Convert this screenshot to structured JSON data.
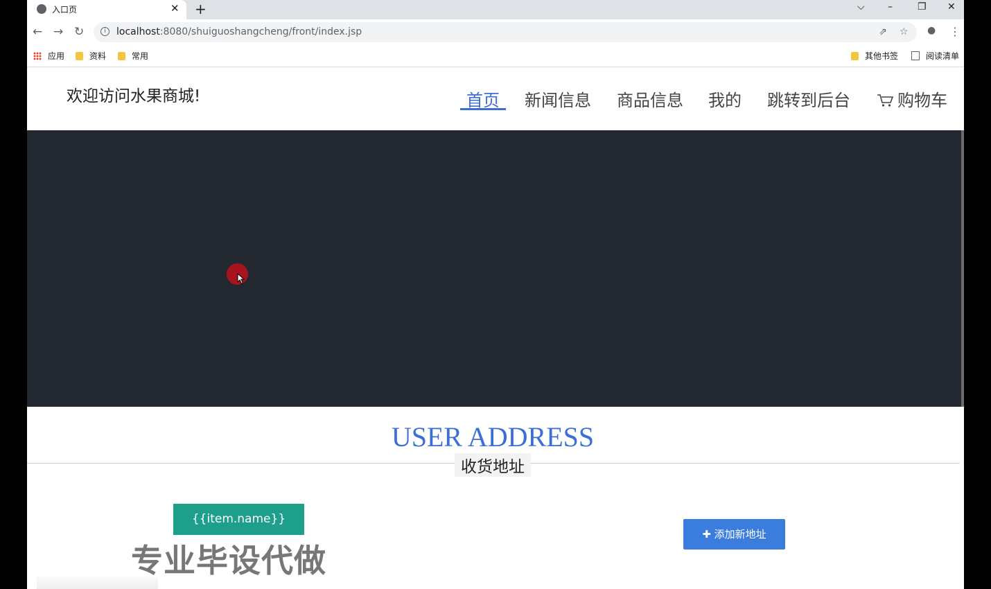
{
  "browser": {
    "tab_title": "入口页",
    "tab_close": "✕",
    "new_tab": "+",
    "window_controls": {
      "tab_search": "⌵",
      "minimize": "–",
      "restore": "❐",
      "close": "✕"
    },
    "nav": {
      "back": "←",
      "forward": "→",
      "reload": "↻"
    },
    "url_host": "localhost",
    "url_path": ":8080/shuiguoshangcheng/front/index.jsp",
    "info_icon": "i",
    "share_icon": "⇗",
    "star_icon": "☆",
    "profile_icon": "●",
    "menu_icon": "⋮",
    "bookmarks": [
      "应用",
      "资料",
      "常用"
    ],
    "other_bookmarks": "其他书签",
    "reading_list": "阅读清单"
  },
  "header": {
    "site_title": "欢迎访问水果商城!",
    "nav": [
      "首页",
      "新闻信息",
      "商品信息",
      "我的",
      "跳转到后台"
    ],
    "cart_label": "购物车",
    "active_index": 0
  },
  "section": {
    "title": "USER ADDRESS",
    "subtitle": "收货地址"
  },
  "address": {
    "name_placeholder": "{{item.name}}",
    "add_button": "✚ 添加新地址"
  },
  "watermark": "专业毕设代做",
  "colors": {
    "accent": "#3b6fd6",
    "banner": "#23272f",
    "teal": "#1d9f8c",
    "button_blue": "#3b7ddd"
  }
}
